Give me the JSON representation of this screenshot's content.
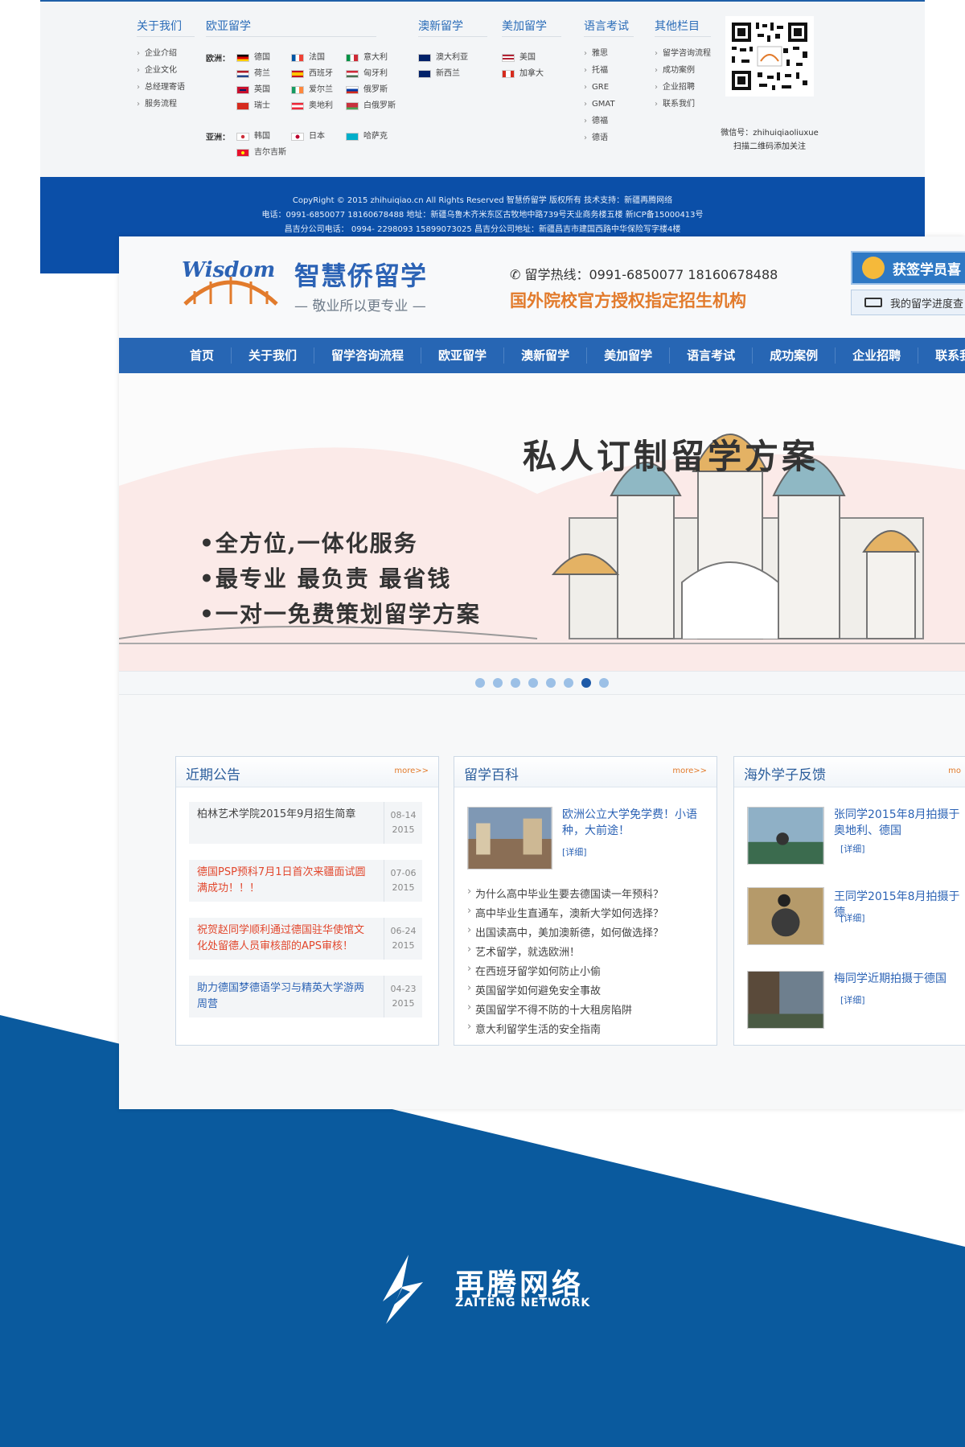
{
  "footer": {
    "columns": [
      {
        "title": "关于我们",
        "items": [
          "企业介绍",
          "企业文化",
          "总经理寄语",
          "服务流程"
        ]
      },
      {
        "title": "欧亚留学"
      },
      {
        "title": "澳新留学"
      },
      {
        "title": "美加留学"
      },
      {
        "title": "语言考试",
        "items": [
          "雅思",
          "托福",
          "GRE",
          "GMAT",
          "德福",
          "德语"
        ]
      },
      {
        "title": "其他栏目",
        "items": [
          "留学咨询流程",
          "成功案例",
          "企业招聘",
          "联系我们"
        ]
      }
    ],
    "europe_label": "欧洲：",
    "asia_label": "亚洲：",
    "europe_countries": [
      "德国",
      "法国",
      "意大利",
      "荷兰",
      "西班牙",
      "匈牙利",
      "英国",
      "爱尔兰",
      "俄罗斯",
      "瑞士",
      "奥地利",
      "白俄罗斯"
    ],
    "asia_countries": [
      "韩国",
      "日本",
      "哈萨克",
      "吉尔吉斯"
    ],
    "oceania_countries": [
      "澳大利亚",
      "新西兰"
    ],
    "america_countries": [
      "美国",
      "加拿大"
    ],
    "wechat_id": "微信号：zhihuiqiaoliuxue",
    "qr_caption": "扫描二维码添加关注",
    "copyright": "CopyRight © 2015 zhihuiqiao.cn All Rights Reserved 智慧侨留学 版权所有 技术支持：新疆再腾网络",
    "contact_line": "电话：0991-6850077 18160678488 地址：新疆乌鲁木齐米东区古牧地中路739号天业商务楼五楼 新ICP备15000413号",
    "branch_line": "昌吉分公司电话： 0994- 2298093 15899073025 昌吉分公司地址：新疆昌吉市建国西路中华保险写字楼4楼"
  },
  "site": {
    "logo_text": "Wisdom",
    "title": "智慧侨留学",
    "slogan": "— 敬业所以更专业 —",
    "hotline": "留学热线：0991-6850077  18160678488",
    "authorized": "国外院校官方授权指定招生机构",
    "side_button_1": "获签学员喜",
    "side_button_2": "我的留学进度查",
    "nav": [
      "首页",
      "关于我们",
      "留学咨询流程",
      "欧亚留学",
      "澳新留学",
      "美加留学",
      "语言考试",
      "成功案例",
      "企业招聘",
      "联系我"
    ],
    "banner": {
      "headline": "私人订制留学方案",
      "bullets": [
        "•全方位,一体化服务",
        "•最专业  最负责  最省钱",
        "•一对一免费策划留学方案"
      ],
      "active_slide": 7,
      "total_slides": 8
    },
    "panels": {
      "notice": {
        "title": "近期公告",
        "more": "more>>",
        "items": [
          {
            "text": "柏林艺术学院2015年9月招生简章",
            "date": "08-14",
            "year": "2015"
          },
          {
            "text": "德国PSP预科7月1日首次来疆面试圆满成功！！！",
            "date": "07-06",
            "year": "2015"
          },
          {
            "text": "祝贺赵同学顺利通过德国驻华使馆文化处留德人员审核部的APS审核！",
            "date": "06-24",
            "year": "2015"
          },
          {
            "text": "助力德国梦德语学习与精英大学游两周营",
            "date": "04-23",
            "year": "2015"
          }
        ]
      },
      "wiki": {
        "title": "留学百科",
        "more": "more>>",
        "feature_title": "欧洲公立大学免学费！小语种，大前途！",
        "detail": "[详细]",
        "items": [
          "为什么高中毕业生要去德国读一年预科？",
          "高中毕业生直通车，澳新大学如何选择？",
          "出国读高中，美加澳新德，如何做选择？",
          "艺术留学，就选欧洲！",
          "在西班牙留学如何防止小偷",
          "英国留学如何避免安全事故",
          "英国留学不得不防的十大租房陷阱",
          "意大利留学生活的安全指南"
        ]
      },
      "feedback": {
        "title": "海外学子反馈",
        "more": "mo",
        "items": [
          {
            "text": "张同学2015年8月拍摄于奥地利、德国",
            "detail": "[详细]"
          },
          {
            "text": "王同学2015年8月拍摄于德",
            "detail": "[详细]"
          },
          {
            "text": "梅同学近期拍摄于德国",
            "detail": "[详细]"
          }
        ]
      }
    }
  },
  "brand": {
    "cn": "再腾网络",
    "en": "ZAITENG NETWORK"
  },
  "colors": {
    "primary_blue": "#2766b4",
    "deep_blue": "#0b4fa8",
    "accent_orange": "#e27b2c",
    "alert_red": "#e2472d"
  }
}
